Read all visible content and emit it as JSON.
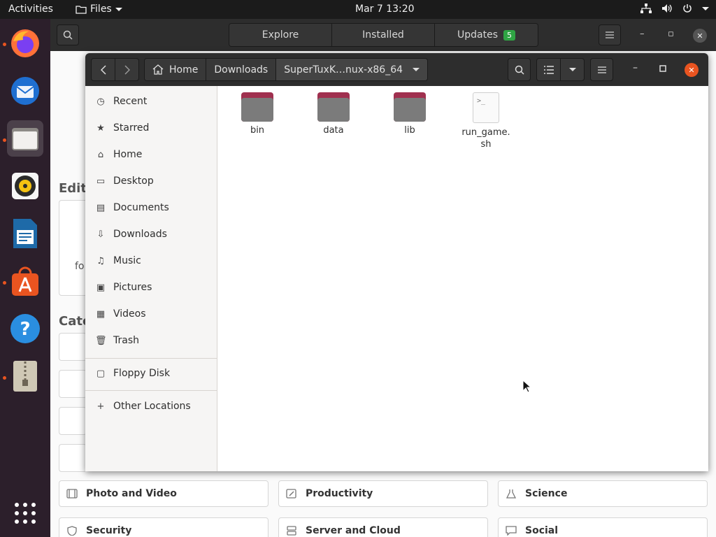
{
  "topbar": {
    "activities": "Activities",
    "app_menu": "Files",
    "clock": "Mar 7  13:20"
  },
  "dock": {
    "items": [
      "firefox-icon",
      "thunderbird-icon",
      "files-icon",
      "rhythmbox-icon",
      "libreoffice-writer-icon",
      "software-center-icon",
      "help-icon",
      "archive-icon"
    ],
    "show_apps": "grid-icon"
  },
  "software": {
    "tabs": [
      {
        "label": "Explore"
      },
      {
        "label": "Installed"
      },
      {
        "label": "Updates",
        "badge": "5"
      }
    ],
    "section_editor": "Edito",
    "section_categories": "Cate",
    "card_text": "fo",
    "categories": [
      {
        "label": "Photo and Video",
        "icon": "film-icon"
      },
      {
        "label": "Productivity",
        "icon": "pencil-icon"
      },
      {
        "label": "Science",
        "icon": "flask-icon"
      },
      {
        "label": "Security",
        "icon": "shield-icon"
      },
      {
        "label": "Server and Cloud",
        "icon": "server-icon"
      },
      {
        "label": "Social",
        "icon": "chat-icon"
      }
    ]
  },
  "files": {
    "breadcrumbs": [
      "Home",
      "Downloads",
      "SuperTuxK…nux-x86_64"
    ],
    "sidebar": [
      {
        "label": "Recent",
        "icon": "clock-icon"
      },
      {
        "label": "Starred",
        "icon": "star-icon"
      },
      {
        "label": "Home",
        "icon": "home-icon"
      },
      {
        "label": "Desktop",
        "icon": "desktop-icon"
      },
      {
        "label": "Documents",
        "icon": "document-icon"
      },
      {
        "label": "Downloads",
        "icon": "download-icon"
      },
      {
        "label": "Music",
        "icon": "music-icon"
      },
      {
        "label": "Pictures",
        "icon": "picture-icon"
      },
      {
        "label": "Videos",
        "icon": "video-icon"
      },
      {
        "label": "Trash",
        "icon": "trash-icon"
      },
      {
        "label": "Floppy Disk",
        "icon": "floppy-icon"
      },
      {
        "label": "Other Locations",
        "icon": "plus-icon"
      }
    ],
    "items": [
      {
        "name": "bin",
        "type": "folder"
      },
      {
        "name": "data",
        "type": "folder"
      },
      {
        "name": "lib",
        "type": "folder"
      },
      {
        "name": "run_game.\nsh",
        "type": "script"
      }
    ],
    "script_glyph": ">_"
  },
  "colors": {
    "accent": "#e95420",
    "header": "#2d2d2d",
    "folder_tab": "#a0304f",
    "folder_body": "#7b7b7b",
    "badge": "#2fa544"
  }
}
